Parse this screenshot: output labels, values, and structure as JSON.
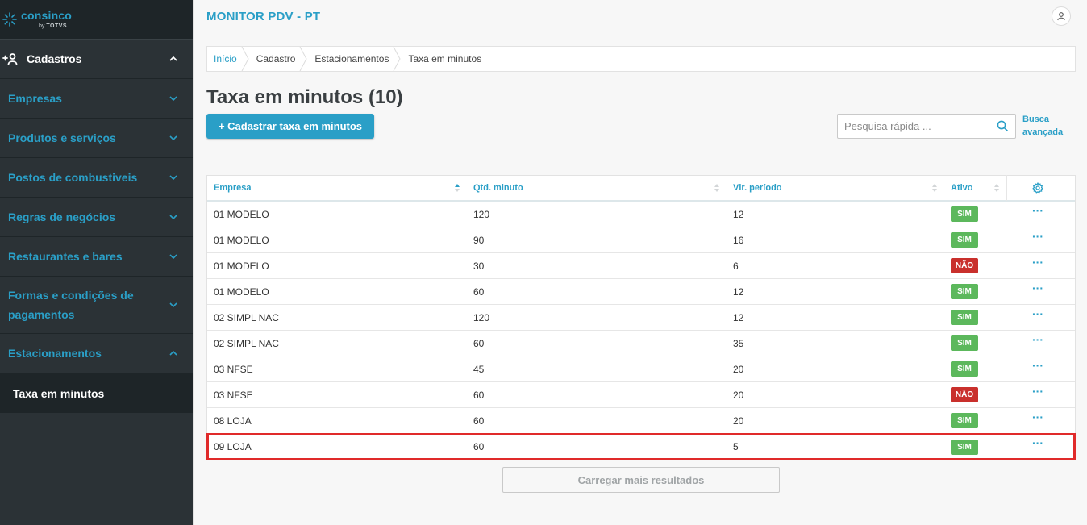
{
  "sidebar": {
    "logo": {
      "name": "consinco",
      "by": "by",
      "brand": "TOTVS"
    },
    "section": {
      "label": "Cadastros"
    },
    "items": [
      {
        "label": "Empresas",
        "expanded": false
      },
      {
        "label": "Produtos e serviços",
        "expanded": false
      },
      {
        "label": "Postos de combustiveis",
        "expanded": false
      },
      {
        "label": "Regras de negócios",
        "expanded": false
      },
      {
        "label": "Restaurantes e bares",
        "expanded": false
      },
      {
        "label": "Formas e condições de pagamentos",
        "expanded": false
      },
      {
        "label": "Estacionamentos",
        "expanded": true
      }
    ],
    "sub_item": {
      "label": "Taxa em minutos"
    }
  },
  "header": {
    "app_title": "MONITOR PDV - PT"
  },
  "breadcrumb": [
    "Início",
    "Cadastro",
    "Estacionamentos",
    "Taxa em minutos"
  ],
  "page": {
    "title": "Taxa em minutos (10)",
    "add_button": "+ Cadastrar taxa em minutos",
    "search_placeholder": "Pesquisa rápida ...",
    "advanced_search": "Busca avançada",
    "load_more": "Carregar mais resultados"
  },
  "table": {
    "columns": [
      "Empresa",
      "Qtd. minuto",
      "Vlr. período",
      "Ativo"
    ],
    "rows": [
      {
        "empresa": "01 MODELO",
        "qtd": "120",
        "vlr": "12",
        "ativo": "SIM"
      },
      {
        "empresa": "01 MODELO",
        "qtd": "90",
        "vlr": "16",
        "ativo": "SIM"
      },
      {
        "empresa": "01 MODELO",
        "qtd": "30",
        "vlr": "6",
        "ativo": "NÃO"
      },
      {
        "empresa": "01 MODELO",
        "qtd": "60",
        "vlr": "12",
        "ativo": "SIM"
      },
      {
        "empresa": "02 SIMPL NAC",
        "qtd": "120",
        "vlr": "12",
        "ativo": "SIM"
      },
      {
        "empresa": "02 SIMPL NAC",
        "qtd": "60",
        "vlr": "35",
        "ativo": "SIM"
      },
      {
        "empresa": "03 NFSE",
        "qtd": "45",
        "vlr": "20",
        "ativo": "SIM"
      },
      {
        "empresa": "03 NFSE",
        "qtd": "60",
        "vlr": "20",
        "ativo": "NÃO"
      },
      {
        "empresa": "08 LOJA",
        "qtd": "60",
        "vlr": "20",
        "ativo": "SIM"
      },
      {
        "empresa": "09 LOJA",
        "qtd": "60",
        "vlr": "5",
        "ativo": "SIM"
      }
    ],
    "row_menu": "···"
  },
  "colors": {
    "accent": "#2a9fc7",
    "sidebar_bg": "#2b3236",
    "badge_yes": "#5cb85c",
    "badge_no": "#c9302c",
    "highlight": "#e02a2a"
  },
  "icons": [
    "consinco-logo-icon",
    "user-add-icon",
    "chevron-up-icon",
    "chevron-down-icon",
    "user-icon",
    "search-icon",
    "sort-icon",
    "gear-icon",
    "more-icon"
  ]
}
